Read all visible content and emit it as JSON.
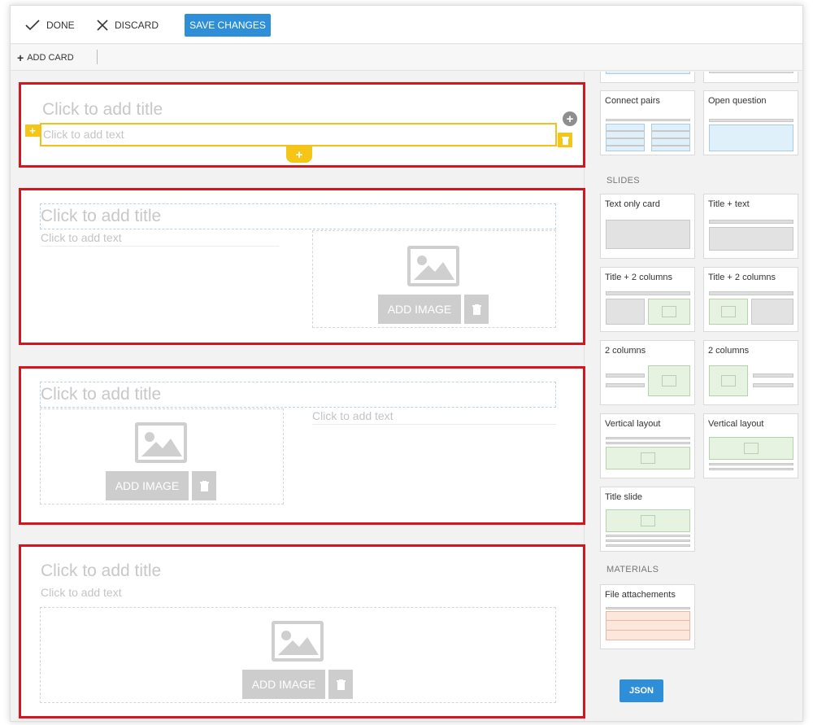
{
  "toolbar": {
    "done_label": "DONE",
    "discard_label": "DISCARD",
    "save_label": "SAVE CHANGES"
  },
  "subbar": {
    "add_card_label": "ADD CARD"
  },
  "cards": {
    "placeholder_title": "Click to add title",
    "placeholder_text": "Click to add text",
    "add_image_label": "ADD IMAGE"
  },
  "sidebar": {
    "question_tiles": [
      "Connect pairs",
      "Open question"
    ],
    "slides_header": "SLIDES",
    "slide_tiles": [
      "Text only card",
      "Title + text",
      "Title + 2 columns",
      "Title + 2 columns",
      "2 columns",
      "2 columns",
      "Vertical layout",
      "Vertical layout",
      "Title slide"
    ],
    "materials_header": "MATERIALS",
    "material_tiles": [
      "File attachements"
    ],
    "json_label": "JSON"
  },
  "colors": {
    "accent_blue": "#2e8fd8",
    "card_border_red": "#d7151e",
    "edit_yellow": "#f5c518"
  },
  "icons": [
    "check-icon",
    "close-icon",
    "plus-icon",
    "image-icon",
    "trash-icon"
  ]
}
